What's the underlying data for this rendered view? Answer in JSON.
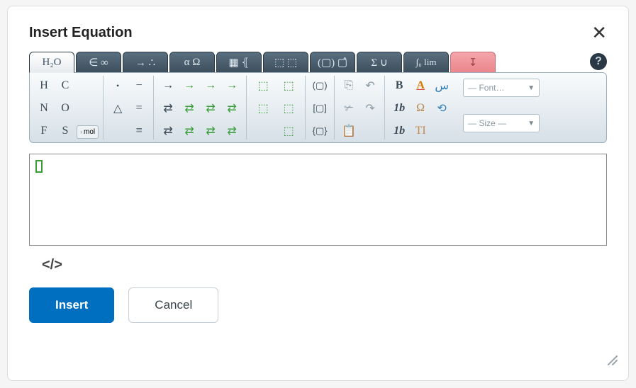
{
  "dialog": {
    "title": "Insert Equation",
    "close": "✕"
  },
  "tabs": {
    "t0": "H₂O",
    "t1": "∈ ∞",
    "t2": "→ ∴",
    "t3": "α Ω",
    "t4": "▦ ⦃",
    "t5": "⬚ ⬚",
    "t6": "(▢) ▢̂",
    "t7": "Σ ∪",
    "t8": "∫₀ lim",
    "t9": "↧"
  },
  "help": "?",
  "ribbon": {
    "g1": {
      "r1c1": "H",
      "r2c1": "N",
      "r3c1": "F",
      "r1c2": "C",
      "r2c2": "O",
      "r3c2": "S"
    },
    "mol": "mol",
    "g2": {
      "dot": "•",
      "tri": "△",
      "minus": "−",
      "eq": "=",
      "equiv": "≡"
    },
    "g3": {
      "r1": "→",
      "r2": "⇄",
      "r3": "⇄",
      "r4": "→",
      "r5": "⇄",
      "r6": "⇄",
      "r7": "→",
      "r8": "⇄",
      "r9": "⇄",
      "r10": "→",
      "r11": "⇄",
      "r12": "⇄"
    },
    "g4": {
      "a": "⬚",
      "b": "⬚",
      "c": "⬚",
      "d": "⬚",
      "e": "⬚"
    },
    "g5": {
      "p1": "(▢)",
      "p2": "[▢]",
      "p3": "{▢}"
    },
    "g6": {
      "copy": "⎘",
      "cut": "✃",
      "paste": "📋",
      "undo": "↶",
      "redo": "↷"
    },
    "g7": {
      "bold": "B",
      "color": "A",
      "oneb": "1b",
      "onebitalic": "1b",
      "omega": "Ω",
      "TI": "TI",
      "rtl": "س",
      "cycle": "⟲"
    },
    "font_placeholder": "— Font…",
    "size_placeholder": "— Size —"
  },
  "editor": {
    "content": ""
  },
  "code_toggle": "</>",
  "buttons": {
    "insert": "Insert",
    "cancel": "Cancel"
  }
}
